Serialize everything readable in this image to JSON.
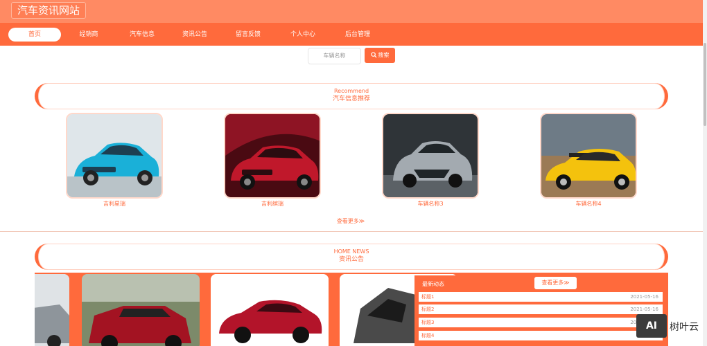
{
  "header": {
    "site_title": "汽车资讯网站"
  },
  "nav": {
    "items": [
      {
        "label": "首页",
        "active": true
      },
      {
        "label": "经销商"
      },
      {
        "label": "汽车信息"
      },
      {
        "label": "资讯公告"
      },
      {
        "label": "留言反馈"
      },
      {
        "label": "个人中心"
      },
      {
        "label": "后台管理"
      }
    ]
  },
  "search": {
    "placeholder": "车辆名称",
    "button_label": "搜索"
  },
  "recommend": {
    "title_en": "Recommend",
    "title_cn": "汽车信息推荐",
    "cars": [
      {
        "name": "吉利星瑞",
        "color": "#1ab0d8"
      },
      {
        "name": "吉利缤瑞",
        "color": "#c0182b"
      },
      {
        "name": "车辆名称3",
        "color": "#9aa0a6"
      },
      {
        "name": "车辆名称4",
        "color": "#f4c20d"
      }
    ],
    "more_label": "查看更多≫"
  },
  "news": {
    "title_en": "HOME NEWS",
    "title_cn": "资讯公告",
    "latest_title": "最新动态",
    "more_label": "查看更多≫",
    "items": [
      {
        "title": "标题1",
        "date": "2021-05-16"
      },
      {
        "title": "标题2",
        "date": "2021-05-16"
      },
      {
        "title": "标题3",
        "date": "2021-05-16"
      },
      {
        "title": "标题4",
        "date": ""
      }
    ]
  },
  "watermark": {
    "logo": "AI",
    "text": "树叶云"
  },
  "colors": {
    "accent": "#ff6a3c",
    "header": "#ff8a63"
  }
}
